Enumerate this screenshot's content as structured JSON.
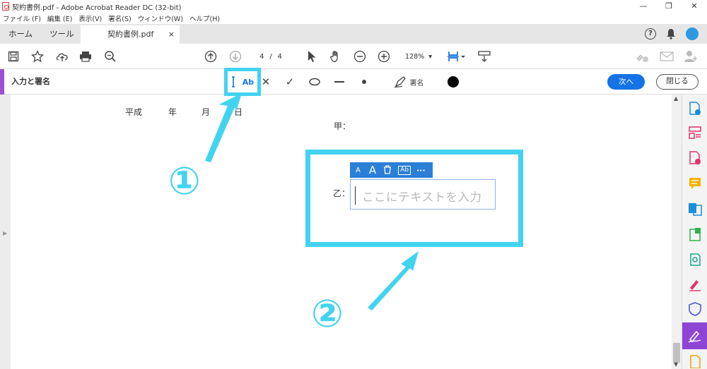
{
  "window": {
    "title": "契約書例.pdf - Adobe Acrobat Reader DC (32-bit)",
    "minimize": "—",
    "maximize": "❐",
    "close": "✕"
  },
  "menu": [
    "ファイル (F)",
    "編集 (E)",
    "表示(V)",
    "署名(S)",
    "ウィンドウ(W)",
    "ヘルプ(H)"
  ],
  "tabs": {
    "home": "ホーム",
    "tools": "ツール",
    "document": "契約書例.pdf",
    "document_close": "×"
  },
  "toolbar": {
    "current_page": "4",
    "page_separator": "/",
    "total_pages": "4",
    "zoom": "128%",
    "zoom_caret": "▾"
  },
  "fill_sign": {
    "label": "入力と署名",
    "add_text_tool": "Ab",
    "cross_mark": "✕",
    "check_mark": "✓",
    "sign_label": "署名",
    "next_button": "次へ",
    "close_button": "閉じる",
    "color": "#000000"
  },
  "document": {
    "date_line": [
      "平成",
      "年",
      "月",
      "日"
    ],
    "party_a": "甲：",
    "party_b": "乙："
  },
  "text_field": {
    "placeholder": "ここにテキストを入力",
    "mini_toolbar": [
      "A",
      "A",
      "🗑",
      "Ab",
      "···"
    ]
  },
  "annotations": {
    "marker_1": "①",
    "marker_2": "②",
    "highlight_color": "#42d3f0"
  },
  "scroll": {
    "up": "▲",
    "down": "▼"
  }
}
